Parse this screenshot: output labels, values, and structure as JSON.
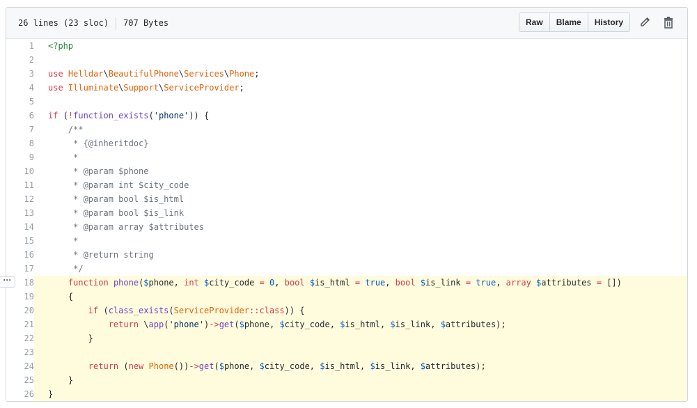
{
  "file_info": {
    "lines": "26 lines (23 sloc)",
    "size": "707 Bytes"
  },
  "toolbar": {
    "raw_label": "Raw",
    "blame_label": "Blame",
    "history_label": "History",
    "edit_icon": "pencil-icon",
    "delete_icon": "trash-icon"
  },
  "code": {
    "lines": [
      {
        "num": "1"
      },
      {
        "num": "2"
      },
      {
        "num": "3"
      },
      {
        "num": "4"
      },
      {
        "num": "5"
      },
      {
        "num": "6"
      },
      {
        "num": "7"
      },
      {
        "num": "8"
      },
      {
        "num": "9"
      },
      {
        "num": "10"
      },
      {
        "num": "11"
      },
      {
        "num": "12"
      },
      {
        "num": "13"
      },
      {
        "num": "14"
      },
      {
        "num": "15"
      },
      {
        "num": "16"
      },
      {
        "num": "17"
      },
      {
        "num": "18"
      },
      {
        "num": "19"
      },
      {
        "num": "20"
      },
      {
        "num": "21"
      },
      {
        "num": "22"
      },
      {
        "num": "23"
      },
      {
        "num": "24"
      },
      {
        "num": "25"
      },
      {
        "num": "26"
      }
    ],
    "highlighted_range": "18-26"
  },
  "colors": {
    "highlight": "#fffbdd",
    "keyword": "#d73a49",
    "comment": "#6a737d",
    "function": "#6f42c1",
    "string": "#032f62",
    "class": "#e36209",
    "constant": "#005cc5"
  },
  "line_actions_icon": "ellipsis-icon"
}
